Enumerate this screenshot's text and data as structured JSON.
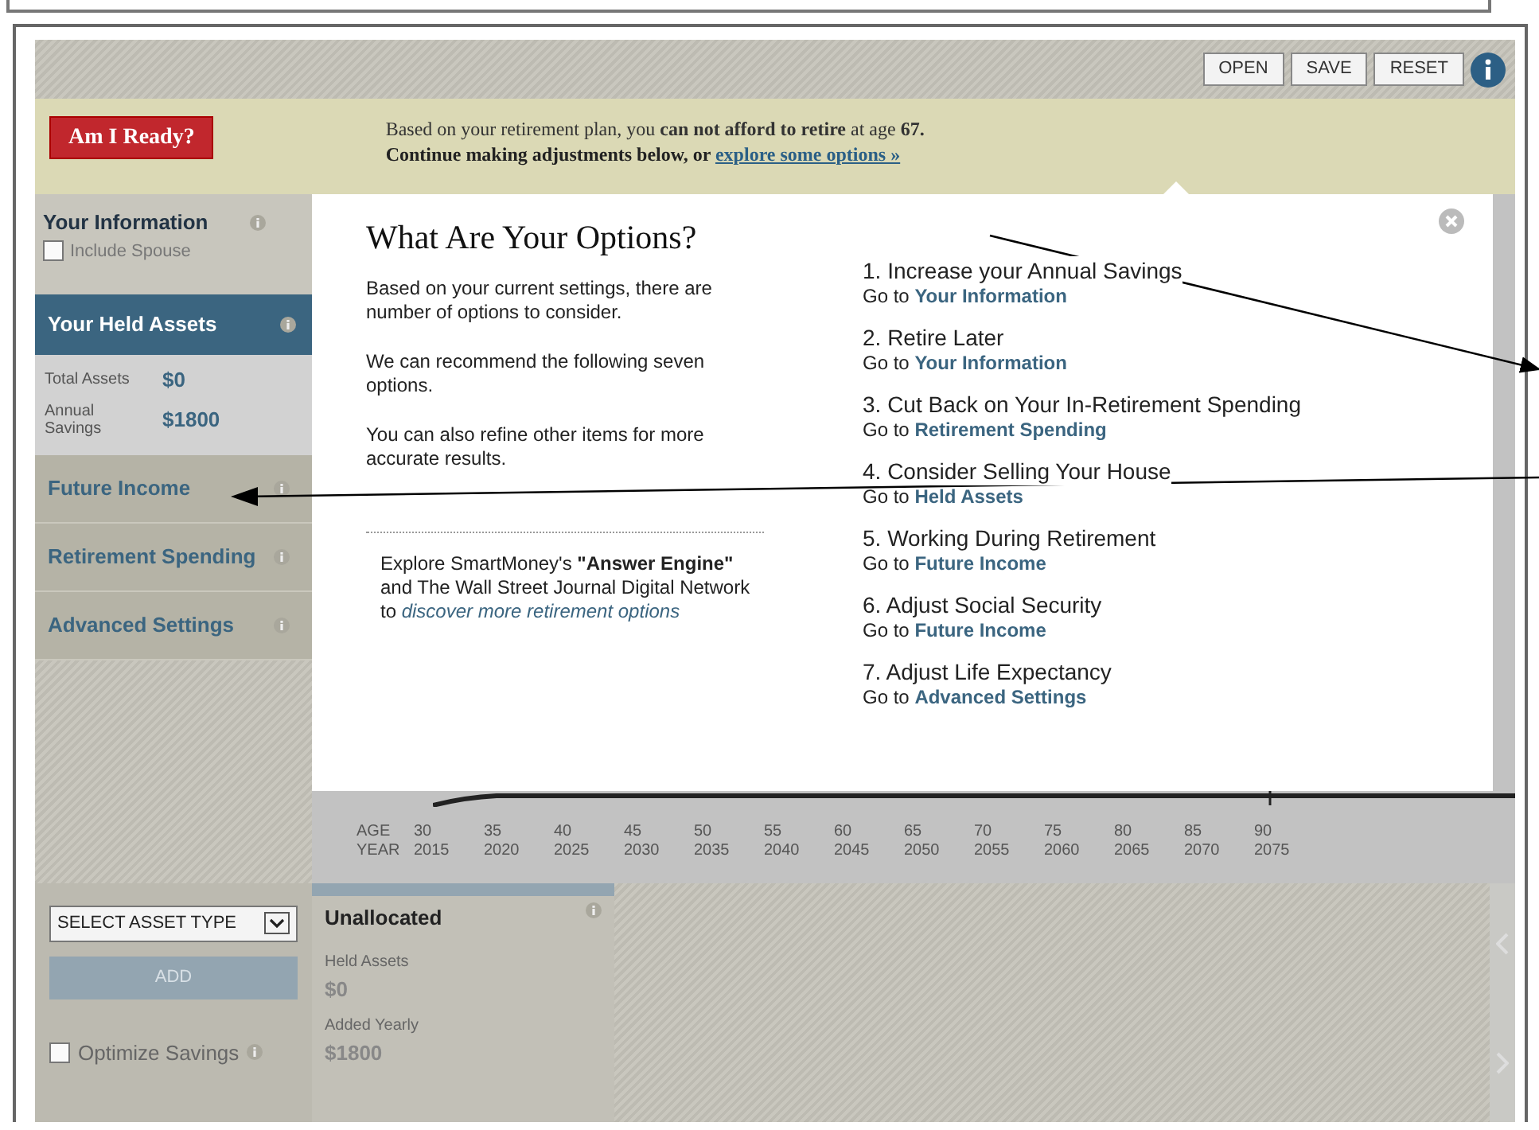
{
  "toolbar": {
    "buttons": [
      "OPEN",
      "SAVE",
      "RESET"
    ]
  },
  "banner": {
    "ready_button": "Am I Ready?",
    "message": "Based on your retirement plan, you **can not afford to retire** at age **67.**",
    "hint": {
      "text": "Continue making adjustments below, or ",
      "link": "explore some options »"
    }
  },
  "sidebar": {
    "your_information": {
      "title": "Your Information",
      "include_spouse": {
        "label": "Include Spouse",
        "checked": false
      }
    },
    "held_assets": {
      "title": "Your Held Assets",
      "selected": true,
      "rows": [
        {
          "label": "Total Assets",
          "value": "$0"
        },
        {
          "label": "Annual Savings",
          "value": "$1800"
        }
      ]
    },
    "sections": [
      {
        "title": "Future Income",
        "selected": false
      },
      {
        "title": "Retirement Spending",
        "selected": false
      },
      {
        "title": "Advanced Settings",
        "selected": false
      }
    ]
  },
  "axis": {
    "age_label": "AGE",
    "year_label": "YEAR",
    "ticks": [
      {
        "age": "30",
        "year": "2015"
      },
      {
        "age": "35",
        "year": "2020"
      },
      {
        "age": "40",
        "year": "2025"
      },
      {
        "age": "45",
        "year": "2030"
      },
      {
        "age": "50",
        "year": "2035"
      },
      {
        "age": "55",
        "year": "2040"
      },
      {
        "age": "60",
        "year": "2045"
      },
      {
        "age": "65",
        "year": "2050"
      },
      {
        "age": "70",
        "year": "2055"
      },
      {
        "age": "75",
        "year": "2060"
      },
      {
        "age": "80",
        "year": "2065"
      },
      {
        "age": "85",
        "year": "2070"
      },
      {
        "age": "90",
        "year": "2075"
      }
    ]
  },
  "bottom": {
    "asset_select": "SELECT ASSET TYPE",
    "add_button": {
      "label": "ADD",
      "disabled": true
    },
    "optimize_savings": {
      "label": "Optimize Savings",
      "checked": false
    },
    "unallocated": {
      "title": "Unallocated",
      "rows": [
        {
          "label": "Held Assets",
          "value": "$0"
        },
        {
          "label": "Added Yearly",
          "value": "$1800"
        }
      ]
    }
  },
  "modal": {
    "title": "What Are Your Options?",
    "paragraphs": [
      "Based on your current settings, there are number of options to consider.",
      "We can recommend the following seven options.",
      "You can also refine other items for more accurate results."
    ],
    "explore": {
      "text": "Explore SmartMoney's **\"Answer Engine\"** and The Wall Street Journal Digital Network to ",
      "link": "discover more retirement options"
    },
    "options": [
      {
        "title": "1. Increase your Annual Savings",
        "prefix": "Go to ",
        "link": "Your Information"
      },
      {
        "title": "2. Retire Later",
        "prefix": "Go to ",
        "link": "Your Information"
      },
      {
        "title": "3. Cut Back on Your In-Retirement Spending",
        "prefix": "Go to ",
        "link": "Retirement Spending"
      },
      {
        "title": "4. Consider Selling Your House",
        "prefix": "Go to ",
        "link": "Held Assets"
      },
      {
        "title": "5. Working During Retirement",
        "prefix": "Go to ",
        "link": "Future Income"
      },
      {
        "title": "6. Adjust Social Security",
        "prefix": "Go to ",
        "link": "Future Income"
      },
      {
        "title": "7. Adjust Life Expectancy",
        "prefix": "Go to ",
        "link": "Advanced Settings"
      }
    ]
  }
}
